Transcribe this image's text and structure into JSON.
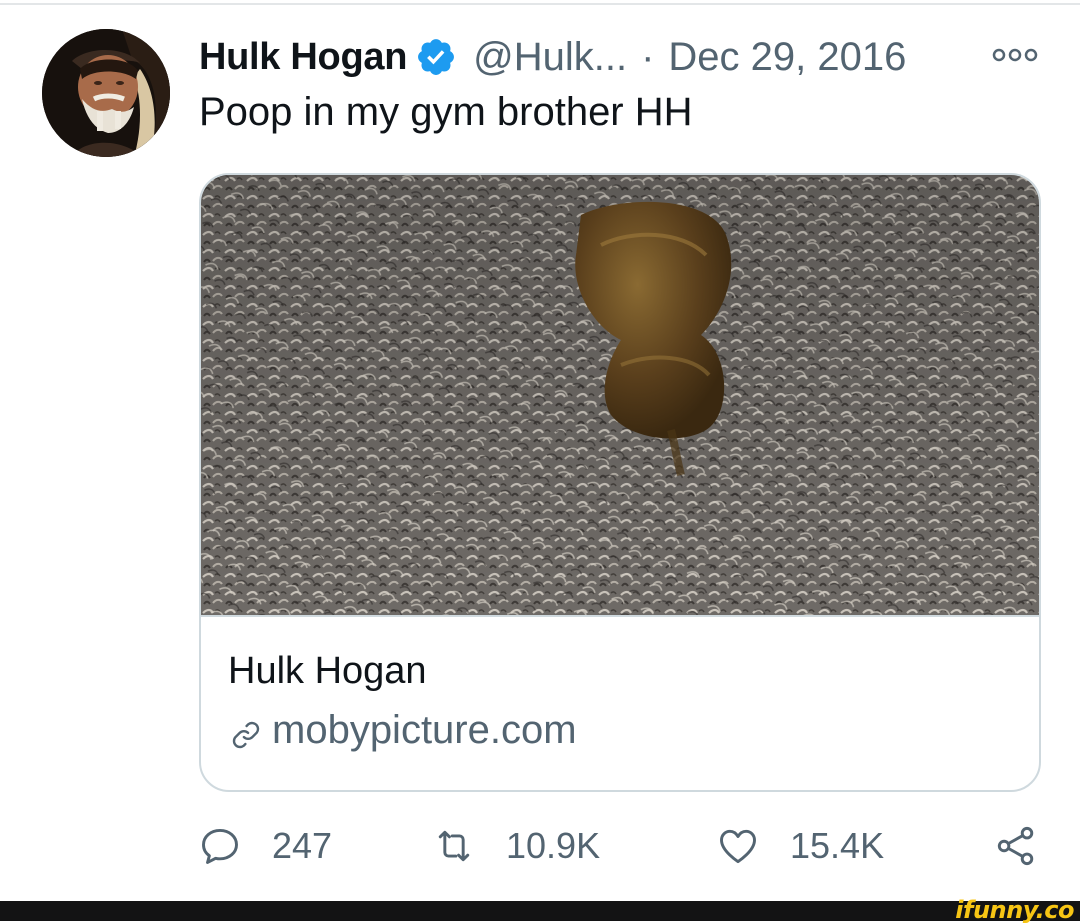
{
  "tweet": {
    "author_name": "Hulk Hogan",
    "handle": "@Hulk...",
    "separator": "·",
    "timestamp": "Dec 29, 2016",
    "text": "Poop in my gym brother HH",
    "verified": true
  },
  "card": {
    "title": "Hulk Hogan",
    "domain": "mobypicture.com"
  },
  "actions": {
    "replies": "247",
    "retweets": "10.9K",
    "likes": "15.4K"
  },
  "watermark": {
    "text": "ifunny.co"
  },
  "icons": {
    "verified": "verified-badge-icon",
    "more": "more-options-icon",
    "link": "link-icon",
    "reply": "reply-icon",
    "retweet": "retweet-icon",
    "like": "heart-icon",
    "share": "share-icon"
  },
  "colors": {
    "verified_blue": "#1d9bf0",
    "secondary_text": "#536471",
    "primary_text": "#0f1419",
    "border": "#cfd9de",
    "watermark_yellow": "#f7c514"
  }
}
